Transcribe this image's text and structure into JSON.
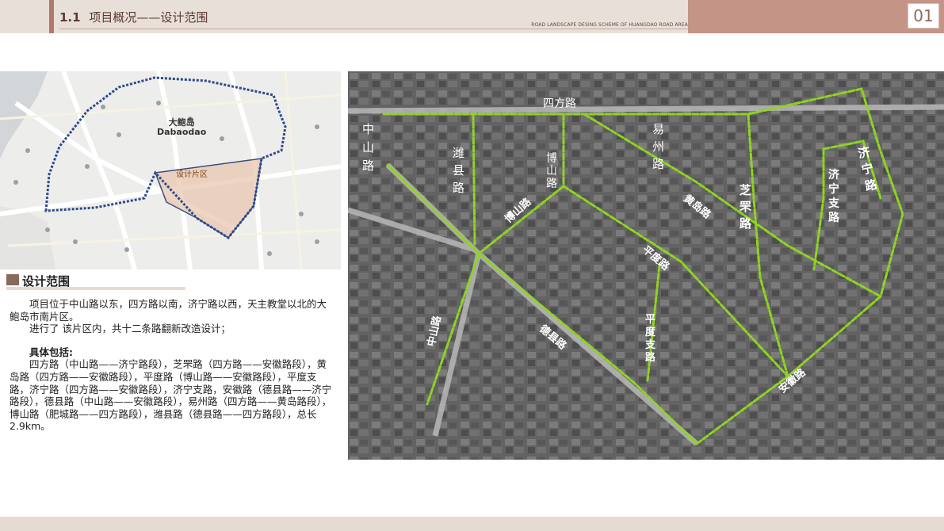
{
  "header": {
    "section_number": "1.1",
    "title": "项目概况——设计范围",
    "subtitle": "ROAD LANDSCAPE DESING SCHEME OF HUANGDAO ROAD AREA",
    "page_number": "01"
  },
  "left_map": {
    "district_name_cn": "大鲍岛",
    "district_name_en": "Dabaodao",
    "design_area_label": "设计片区"
  },
  "section": {
    "title": "设计范围"
  },
  "content": {
    "para1": "项目位于中山路以东，四方路以南，济宁路以西，天主教堂以北的大鲍岛市南片区。",
    "para2": "进行了 该片区内，共十二条路翻新改造设计；",
    "subhead": "具体包括:",
    "details": "四方路（中山路——济宁路段），芝罘路（四方路——安徽路段），黄岛路（四方路——安徽路段），平度路（博山路——安徽路段），平度支路，济宁路（四方路——安徽路段），济宁支路，安徽路（德县路——济宁路段），德县路（中山路——安徽路段），易州路（四方路——黄岛路段），博山路（肥城路——四方路段），潍县路（德县路——四方路段），总长2.9km。"
  },
  "aerial": {
    "road_labels": {
      "sifang": "四方路",
      "zhongshan_top": "中山路",
      "weixian": "潍县路",
      "boshan": "博山路",
      "boshan_south": "博山路",
      "yizhou": "易州路",
      "huangdao": "黄岛路",
      "zhifu": "芝罘路",
      "jining": "济宁路",
      "jining_branch": "济宁支路",
      "pingdu": "平度路",
      "pingdu_branch": "平度支路",
      "dexian": "德县路",
      "zhongshan_bottom": "中山路",
      "anhui": "安徽路"
    },
    "colors": {
      "road_line": "#8fd420",
      "boundary": "#2d4a8a"
    }
  }
}
